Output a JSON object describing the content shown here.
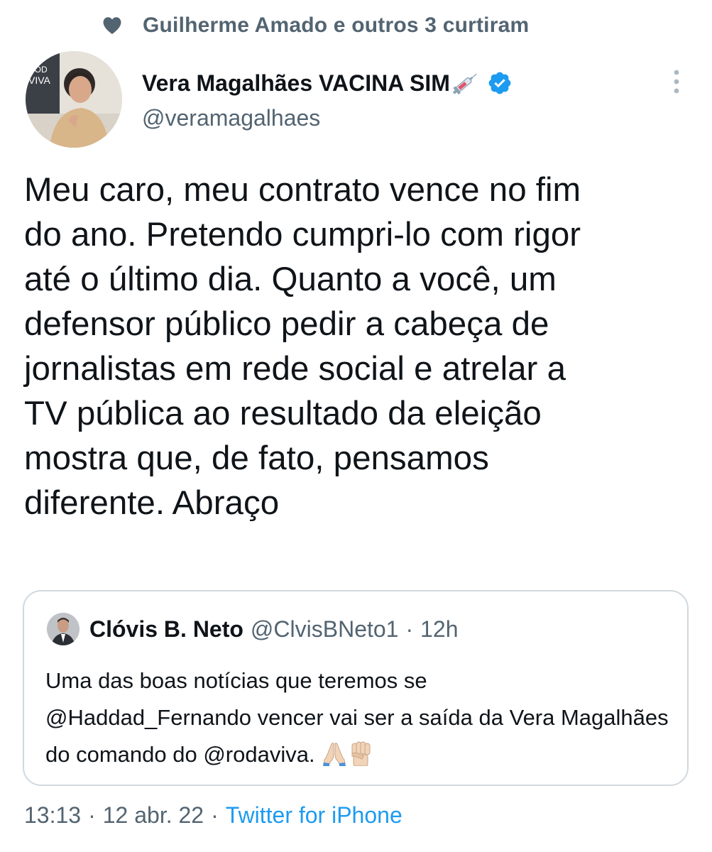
{
  "social_context": {
    "icon": "heart-icon",
    "text": "Guilherme Amado e outros 3 curtiram"
  },
  "author": {
    "display_name": "Vera Magalhães VACINA SIM",
    "name_emoji": "syringe-icon",
    "verified": true,
    "handle": "@veramagalhaes",
    "avatar_overlay_text": "ROD VIVA"
  },
  "tweet": {
    "text": "Meu caro, meu contrato vence no fim\ndo ano. Pretendo cumpri-lo com rigor\naté o último dia. Quanto a você, um\ndefensor público pedir a cabeça de\njornalistas em rede social e atrelar a\nTV pública ao resultado da eleição\nmostra que, de fato, pensamos\ndiferente. Abraço"
  },
  "quote": {
    "name": "Clóvis B. Neto",
    "handle": "@ClvisBNeto1",
    "separator": "·",
    "time": "12h",
    "text_part1": "Uma das boas notícias que teremos se",
    "mention1": "@Haddad_Fernando",
    "text_part2": " vencer vai ser a saída da Vera Magalhães do comando do ",
    "mention2": "@rodaviva",
    "text_part3": ".",
    "emojis": [
      "folded-hands-icon",
      "raised-fist-icon"
    ]
  },
  "meta": {
    "time": "13:13",
    "separator": "·",
    "date": "12 abr. 22",
    "source": "Twitter for iPhone"
  },
  "colors": {
    "text_primary": "#0f1419",
    "text_secondary": "#536471",
    "link": "#1d9bf0",
    "border": "#cfd9de",
    "verified": "#1d9bf0"
  }
}
